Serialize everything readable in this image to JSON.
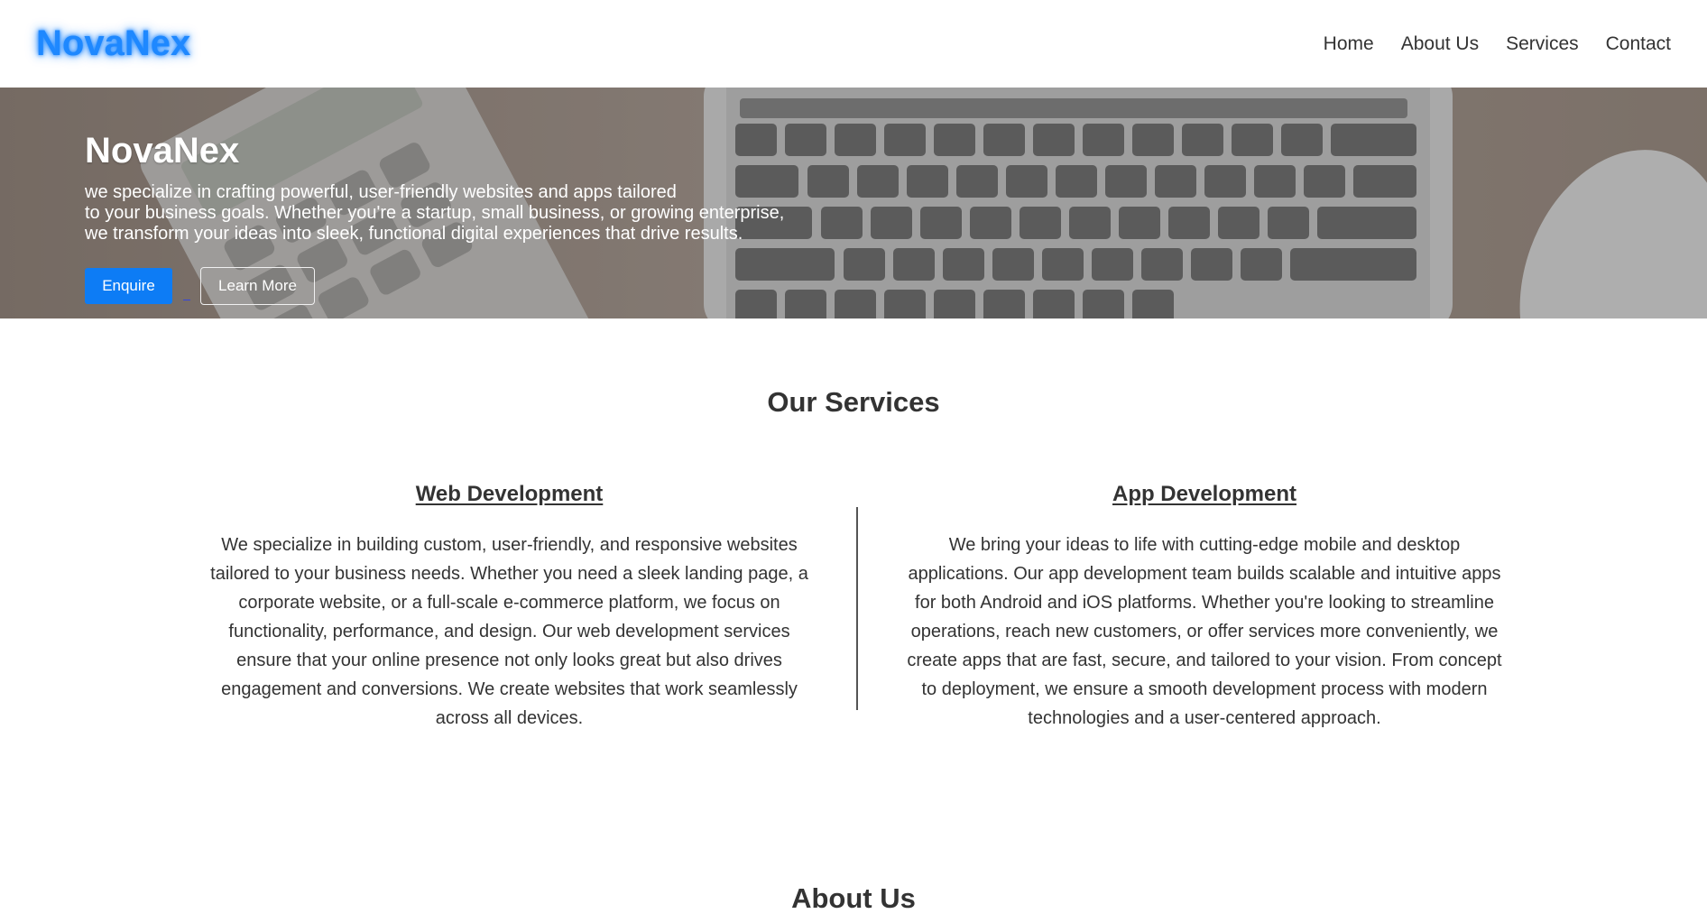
{
  "header": {
    "logo": "NovaNex",
    "nav": [
      "Home",
      "About Us",
      "Services",
      "Contact"
    ]
  },
  "hero": {
    "title": "NovaNex",
    "text_lines": [
      "we specialize in crafting powerful, user-friendly websites and apps tailored",
      "to your business goals. Whether you're a startup, small business, or growing enterprise,",
      "we transform your ideas into sleek, functional digital experiences that drive results."
    ],
    "enquire_label": "Enquire",
    "learn_more_label": "Learn More"
  },
  "services": {
    "title": "Our Services",
    "web": {
      "heading": "Web Development",
      "lines": [
        "We specialize in building custom, user-friendly, and responsive websites",
        "tailored to your business needs. Whether you need a sleek landing page, a",
        "corporate website, or a full-scale e-commerce platform, we focus on",
        "functionality, performance, and design. Our web development services",
        "ensure that your online presence not only looks great but also drives",
        "engagement and conversions. We create websites that work seamlessly",
        "across all devices."
      ]
    },
    "app": {
      "heading": "App Development",
      "lines": [
        "We bring your ideas to life with cutting-edge mobile and desktop",
        "applications. Our app development team builds scalable and intuitive apps",
        "for both Android and iOS platforms. Whether you're looking to streamline",
        "operations, reach new customers, or offer services more conveniently, we",
        "create apps that are fast, secure, and tailored to your vision. From concept",
        "to deployment, we ensure a smooth development process with modern",
        "technologies and a user-centered approach."
      ]
    }
  },
  "about": {
    "title": "About Us"
  },
  "colors": {
    "brand_blue": "#1e88ff",
    "button_blue": "#0d7cf5",
    "text": "#333333"
  }
}
